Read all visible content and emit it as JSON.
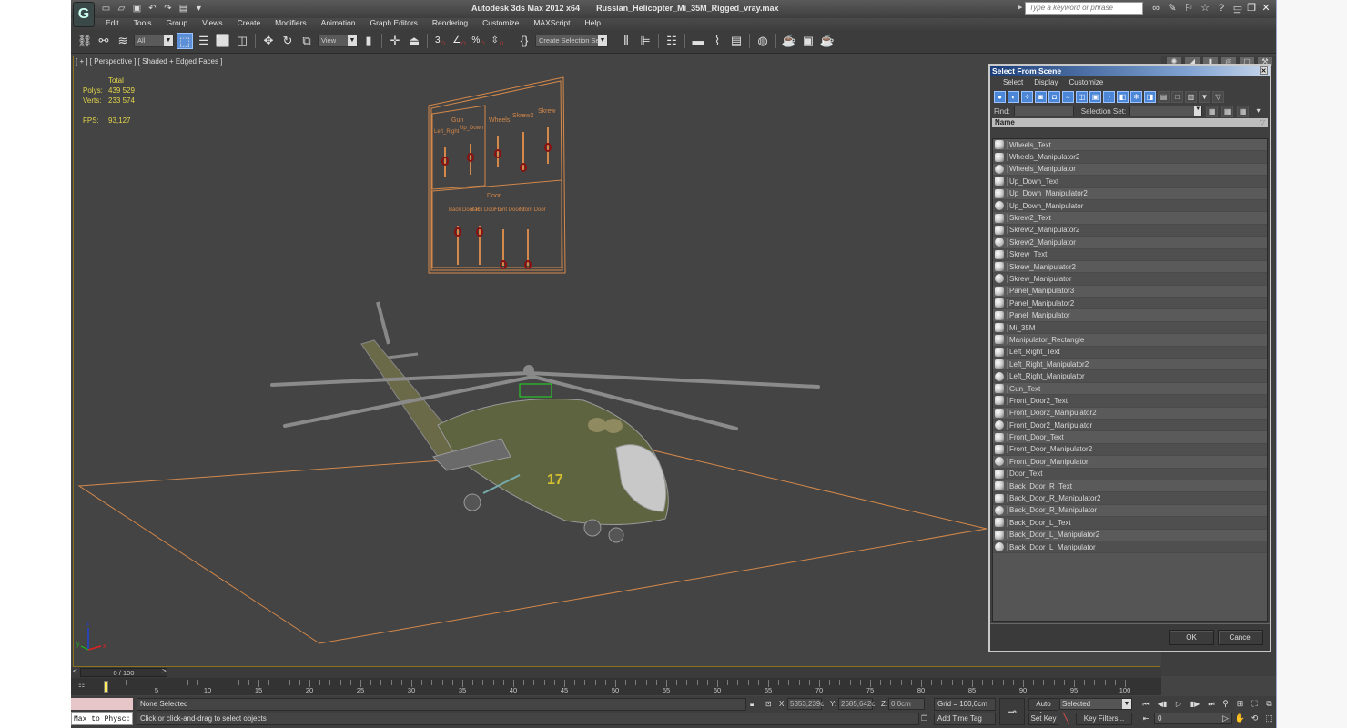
{
  "app": {
    "name": "Autodesk 3ds Max  2012 x64",
    "file": "Russian_Helicopter_Mi_35M_Rigged_vray.max",
    "search_placeholder": "Type a keyword or phrase"
  },
  "menu": [
    "Edit",
    "Tools",
    "Group",
    "Views",
    "Create",
    "Modifiers",
    "Animation",
    "Graph Editors",
    "Rendering",
    "Customize",
    "MAXScript",
    "Help"
  ],
  "toolbar": {
    "selection_filter": "All",
    "reference_coord": "View",
    "named_selection_placeholder": "Create Selection Se",
    "snap_3d_label": "3",
    "percent_snap_label": "%"
  },
  "viewport": {
    "label": "[ + ] [ Perspective ] [ Shaded + Edged Faces ]",
    "stats": {
      "header": "Total",
      "polys_label": "Polys:",
      "polys": "439 529",
      "verts_label": "Verts:",
      "verts": "233 574",
      "fps_label": "FPS:",
      "fps": "93,127"
    },
    "panel_labels": {
      "gun": "Gun",
      "up_down": "Up_Down",
      "left_right": "Left_Right",
      "wheels": "Wheels",
      "skrew2": "Skrew2",
      "skrew": "Skrew",
      "door": "Door",
      "back_door_r": "Back Door R",
      "back_door_l": "Back Door L",
      "front_door2": "Front Door 2",
      "front_door": "Front Door"
    },
    "axis_labels": {
      "x": "x",
      "y": "y",
      "z": "z"
    }
  },
  "dialog": {
    "title": "Select From Scene",
    "menu": [
      "Select",
      "Display",
      "Customize"
    ],
    "find_label": "Find:",
    "find_value": "",
    "selection_set_label": "Selection Set:",
    "selection_set_value": "",
    "column_name": "Name",
    "items": [
      {
        "name": "Wheels_Text",
        "icon": "text-shape-icon"
      },
      {
        "name": "Wheels_Manipulator2",
        "icon": "text-shape-icon"
      },
      {
        "name": "Wheels_Manipulator",
        "icon": "sphere-icon"
      },
      {
        "name": "Up_Down_Text",
        "icon": "text-shape-icon"
      },
      {
        "name": "Up_Down_Manipulator2",
        "icon": "text-shape-icon"
      },
      {
        "name": "Up_Down_Manipulator",
        "icon": "sphere-icon"
      },
      {
        "name": "Skrew2_Text",
        "icon": "text-shape-icon"
      },
      {
        "name": "Skrew2_Manipulator2",
        "icon": "text-shape-icon"
      },
      {
        "name": "Skrew2_Manipulator",
        "icon": "sphere-icon"
      },
      {
        "name": "Skrew_Text",
        "icon": "text-shape-icon"
      },
      {
        "name": "Skrew_Manipulator2",
        "icon": "text-shape-icon"
      },
      {
        "name": "Skrew_Manipulator",
        "icon": "sphere-icon"
      },
      {
        "name": "Panel_Manipulator3",
        "icon": "text-shape-icon"
      },
      {
        "name": "Panel_Manipulator2",
        "icon": "text-shape-icon"
      },
      {
        "name": "Panel_Manipulator",
        "icon": "text-shape-icon"
      },
      {
        "name": "Mi_35M",
        "icon": "group-icon"
      },
      {
        "name": "Manipulator_Rectangle",
        "icon": "text-shape-icon"
      },
      {
        "name": "Left_Right_Text",
        "icon": "text-shape-icon"
      },
      {
        "name": "Left_Right_Manipulator2",
        "icon": "text-shape-icon"
      },
      {
        "name": "Left_Right_Manipulator",
        "icon": "sphere-icon"
      },
      {
        "name": "Gun_Text",
        "icon": "text-shape-icon"
      },
      {
        "name": "Front_Door2_Text",
        "icon": "text-shape-icon"
      },
      {
        "name": "Front_Door2_Manipulator2",
        "icon": "text-shape-icon"
      },
      {
        "name": "Front_Door2_Manipulator",
        "icon": "sphere-icon"
      },
      {
        "name": "Front_Door_Text",
        "icon": "text-shape-icon"
      },
      {
        "name": "Front_Door_Manipulator2",
        "icon": "text-shape-icon"
      },
      {
        "name": "Front_Door_Manipulator",
        "icon": "sphere-icon"
      },
      {
        "name": "Door_Text",
        "icon": "text-shape-icon"
      },
      {
        "name": "Back_Door_R_Text",
        "icon": "text-shape-icon"
      },
      {
        "name": "Back_Door_R_Manipulator2",
        "icon": "text-shape-icon"
      },
      {
        "name": "Back_Door_R_Manipulator",
        "icon": "sphere-icon"
      },
      {
        "name": "Back_Door_L_Text",
        "icon": "text-shape-icon"
      },
      {
        "name": "Back_Door_L_Manipulator2",
        "icon": "text-shape-icon"
      },
      {
        "name": "Back_Door_L_Manipulator",
        "icon": "sphere-icon"
      }
    ],
    "ok_label": "OK",
    "cancel_label": "Cancel"
  },
  "timeline": {
    "slider_label": "0 / 100",
    "current_frame": 0,
    "total_frames": 100,
    "ticks": [
      "0",
      "5",
      "10",
      "15",
      "20",
      "25",
      "30",
      "35",
      "40",
      "45",
      "50",
      "55",
      "60",
      "65",
      "70",
      "75",
      "80",
      "85",
      "90",
      "95",
      "100"
    ]
  },
  "status": {
    "listener_text": "Max to Physc:",
    "selection_status": "None Selected",
    "prompt": "Click or click-and-drag to select objects",
    "x_label": "X:",
    "x_value": "5353,239c",
    "y_label": "Y:",
    "y_value": "2685,642c",
    "z_label": "Z:",
    "z_value": "0,0cm",
    "grid": "Grid = 100,0cm",
    "add_time_tag": "Add Time Tag",
    "auto_key": "Auto Key",
    "set_key": "Set Key",
    "key_mode_selected": "Selected",
    "key_filters": "Key Filters...",
    "frame_value": "0"
  },
  "colors": {
    "accent_blue": "#4c86d6",
    "viewport_border": "#8a7220",
    "stats_yellow": "#e4d64a",
    "wire_orange": "#d4884a",
    "manipulator_red": "#8b1010"
  }
}
